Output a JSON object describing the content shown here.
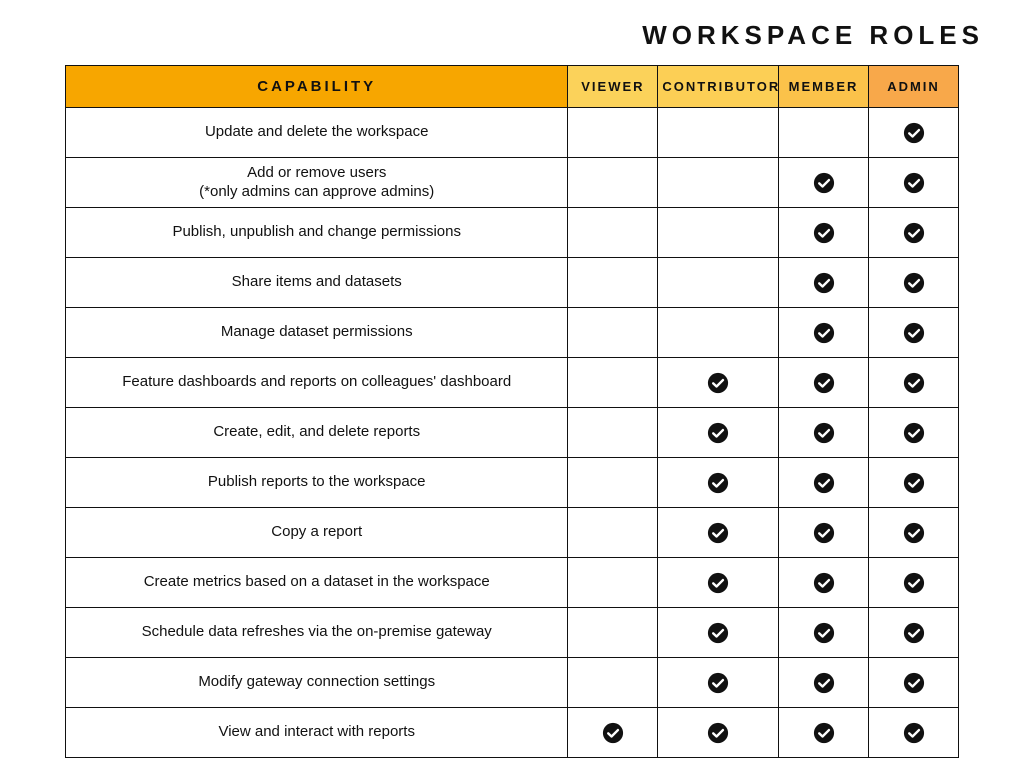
{
  "title": "WORKSPACE ROLES",
  "chart_data": {
    "type": "table",
    "title": "WORKSPACE ROLES",
    "columns": [
      "CAPABILITY",
      "VIEWER",
      "CONTRIBUTOR",
      "MEMBER",
      "ADMIN"
    ],
    "rows": [
      {
        "capability": "Update and delete the workspace",
        "viewer": false,
        "contributor": false,
        "member": false,
        "admin": true
      },
      {
        "capability": "Add or remove users\n(*only admins can approve admins)",
        "viewer": false,
        "contributor": false,
        "member": true,
        "admin": true
      },
      {
        "capability": "Publish, unpublish and change permissions",
        "viewer": false,
        "contributor": false,
        "member": true,
        "admin": true
      },
      {
        "capability": "Share items and datasets",
        "viewer": false,
        "contributor": false,
        "member": true,
        "admin": true
      },
      {
        "capability": "Manage dataset permissions",
        "viewer": false,
        "contributor": false,
        "member": true,
        "admin": true
      },
      {
        "capability": "Feature dashboards and reports on colleagues' dashboard",
        "viewer": false,
        "contributor": true,
        "member": true,
        "admin": true
      },
      {
        "capability": "Create, edit, and delete reports",
        "viewer": false,
        "contributor": true,
        "member": true,
        "admin": true
      },
      {
        "capability": "Publish reports to the workspace",
        "viewer": false,
        "contributor": true,
        "member": true,
        "admin": true
      },
      {
        "capability": "Copy a report",
        "viewer": false,
        "contributor": true,
        "member": true,
        "admin": true
      },
      {
        "capability": "Create metrics based on a dataset in the workspace",
        "viewer": false,
        "contributor": true,
        "member": true,
        "admin": true
      },
      {
        "capability": "Schedule data refreshes via the on-premise gateway",
        "viewer": false,
        "contributor": true,
        "member": true,
        "admin": true
      },
      {
        "capability": "Modify gateway connection settings",
        "viewer": false,
        "contributor": true,
        "member": true,
        "admin": true
      },
      {
        "capability": "View and interact with reports",
        "viewer": true,
        "contributor": true,
        "member": true,
        "admin": true
      }
    ]
  }
}
